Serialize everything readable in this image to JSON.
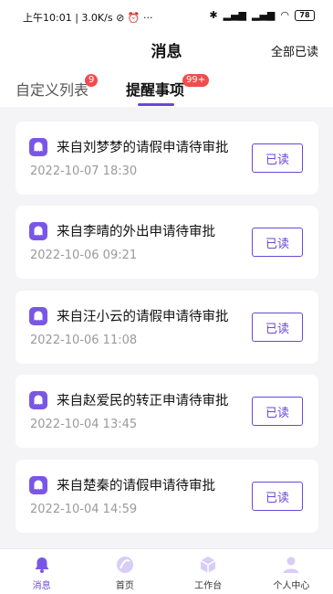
{
  "status_bar": {
    "time": "上午10:01",
    "net_speed": "3.0K/s",
    "battery": "78"
  },
  "header": {
    "title": "消息",
    "read_all": "全部已读"
  },
  "tabs": [
    {
      "label": "自定义列表",
      "badge": "9"
    },
    {
      "label": "提醒事项",
      "badge": "99+"
    }
  ],
  "messages": [
    {
      "title": "来自刘梦梦的请假申请待审批",
      "time": "2022-10-07 18:30",
      "button": "已读"
    },
    {
      "title": "来自李晴的外出申请待审批",
      "time": "2022-10-06 09:21",
      "button": "已读"
    },
    {
      "title": "来自汪小云的请假申请待审批",
      "time": "2022-10-06 11:08",
      "button": "已读"
    },
    {
      "title": "来自赵爱民的转正申请待审批",
      "time": "2022-10-04 13:45",
      "button": "已读"
    },
    {
      "title": "来自楚秦的请假申请待审批",
      "time": "2022-10-04 14:59",
      "button": "已读"
    }
  ],
  "bottom_nav": [
    {
      "label": "消息",
      "icon": "bell-icon"
    },
    {
      "label": "首页",
      "icon": "home-icon"
    },
    {
      "label": "工作台",
      "icon": "cube-icon"
    },
    {
      "label": "个人中心",
      "icon": "person-icon"
    }
  ],
  "colors": {
    "accent": "#6a48d7",
    "badge": "#ef4d4d",
    "background": "#f4f4f6"
  }
}
